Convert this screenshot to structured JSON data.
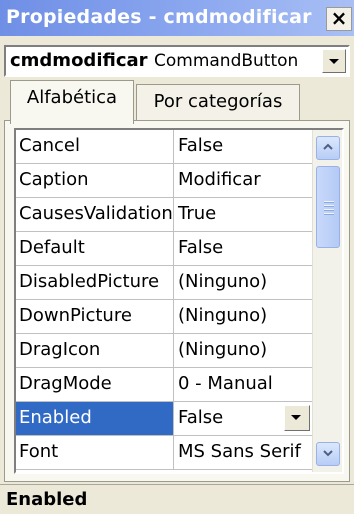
{
  "window": {
    "title": "Propiedades - cmdmodificar",
    "close_label": "×"
  },
  "object_selector": {
    "name": "cmdmodificar",
    "type": "CommandButton"
  },
  "tabs": [
    {
      "label": "Alfabética",
      "active": true
    },
    {
      "label": "Por categorías",
      "active": false
    }
  ],
  "properties": [
    {
      "name": "Cancel",
      "value": "False"
    },
    {
      "name": "Caption",
      "value": "Modificar"
    },
    {
      "name": "CausesValidation",
      "value": "True"
    },
    {
      "name": "Default",
      "value": "False"
    },
    {
      "name": "DisabledPicture",
      "value": "(Ninguno)"
    },
    {
      "name": "DownPicture",
      "value": "(Ninguno)"
    },
    {
      "name": "DragIcon",
      "value": "(Ninguno)"
    },
    {
      "name": "DragMode",
      "value": "0 - Manual"
    },
    {
      "name": "Enabled",
      "value": "False",
      "selected": true
    },
    {
      "name": "Font",
      "value": "MS Sans Serif"
    }
  ],
  "status": {
    "description_title": "Enabled"
  },
  "colors": {
    "selection": "#316ac5",
    "titlebar": "#8ba7ef"
  }
}
